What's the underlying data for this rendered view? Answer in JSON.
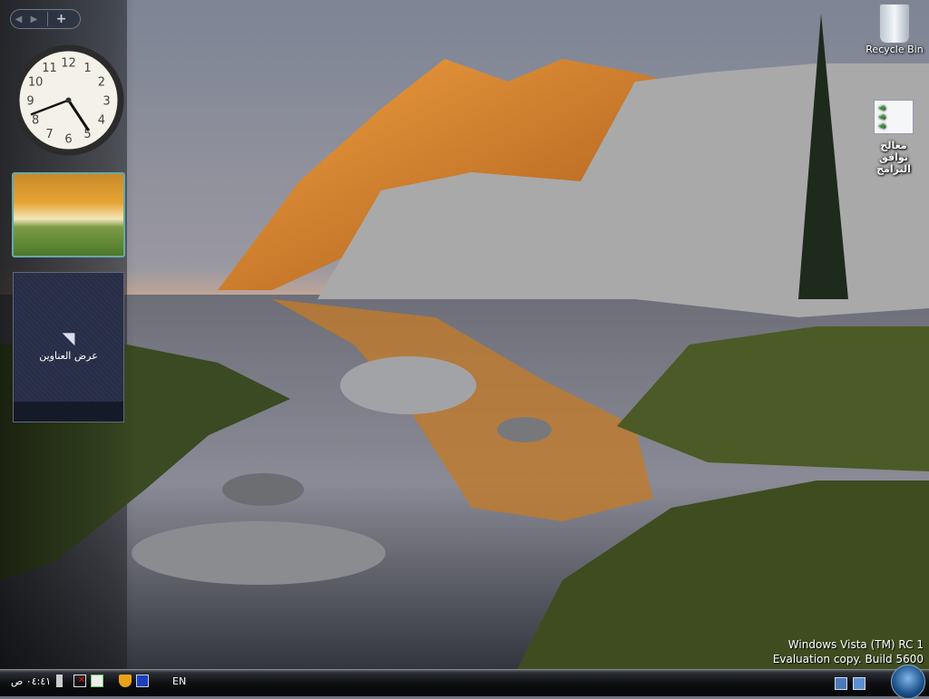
{
  "desktop": {
    "icons": [
      {
        "label": "Recycle Bin"
      },
      {
        "label": "معالج توافق البرامج"
      }
    ],
    "watermark": {
      "line1": "Windows Vista (TM) RC 1",
      "line2": "Evaluation copy. Build 5600"
    }
  },
  "sidebar": {
    "nav": {
      "prev": "◀",
      "next": "▶",
      "add": "+"
    },
    "clock": {
      "time": "4:41",
      "numbers": [
        "12",
        "1",
        "2",
        "3",
        "4",
        "5",
        "6",
        "7",
        "8",
        "9",
        "10",
        "11"
      ]
    },
    "feed": {
      "label": "عرض العناوين"
    }
  },
  "taskbar": {
    "clock": "٠٤:٤١ ص",
    "language": "EN",
    "tray_icons": [
      "volume-icon",
      "network-disconnected-icon",
      "power-icon",
      "security-center-icon",
      "display-icon"
    ]
  }
}
